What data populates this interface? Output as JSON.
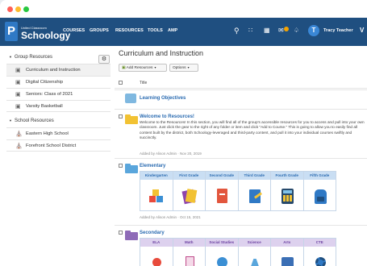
{
  "window": {
    "controls": [
      "close",
      "minimize",
      "maximize"
    ]
  },
  "brand": {
    "small": "United Classroom",
    "name": "Schoology",
    "letter": "P"
  },
  "nav": {
    "links": [
      "COURSES",
      "GROUPS",
      "RESOURCES",
      "TOOLS",
      "AMP"
    ],
    "icons": [
      "search-icon",
      "apps-icon",
      "calendar-icon",
      "messages-icon",
      "notifications-icon"
    ],
    "user": {
      "initial": "T",
      "name": "Tracy Teacher",
      "chevron": "V"
    }
  },
  "sidebar": {
    "group_header": "Group Resources",
    "group_items": [
      "Curriculum and Instruction",
      "Digital Citizenship",
      "Seniors: Class of 2021",
      "Varsity Basketball"
    ],
    "school_header": "School Resources",
    "school_items": [
      "Eastern High School",
      "Forefront School District"
    ]
  },
  "main": {
    "title": "Curriculum and Instruction",
    "add_button": "Add Resources",
    "options_button": "Options",
    "column_title": "Title"
  },
  "rows": {
    "learning": {
      "title": "Learning Objectives"
    },
    "welcome": {
      "title": "Welcome to Resources!",
      "description": "Welcome to the Resources! In this section, you will find all of the group's accessible resources for you to access and pull into your own classroom. Just click the gear to the right of any folder or item and click \"Add to Course.\" This is going to allow you to easily find all content built by the district, both Schoology-leveraged and third-party content, and pull it into your individual courses swiftly and succinctly.",
      "meta": "Added by Alison Admin · Nov 20, 2019"
    },
    "elementary": {
      "title": "Elementary",
      "headers": [
        "Kindergarten",
        "First Grade",
        "Second Grade",
        "Third Grade",
        "Fourth Grade",
        "Fifth Grade"
      ],
      "meta": "Added by Alison Admin · Oct 15, 2021"
    },
    "secondary": {
      "title": "Secondary",
      "headers": [
        "ELA",
        "Math",
        "Social Studies",
        "Science",
        "Arts",
        "CTE"
      ]
    }
  },
  "colors": {
    "nav": "#1f4f80",
    "link": "#2a6bb1",
    "folder_yellow": "#f2c233",
    "folder_blue": "#5aa6dc",
    "folder_purple": "#8e6bb8",
    "elem_header": "#c9def3",
    "sec_header": "#ddd1ee"
  }
}
